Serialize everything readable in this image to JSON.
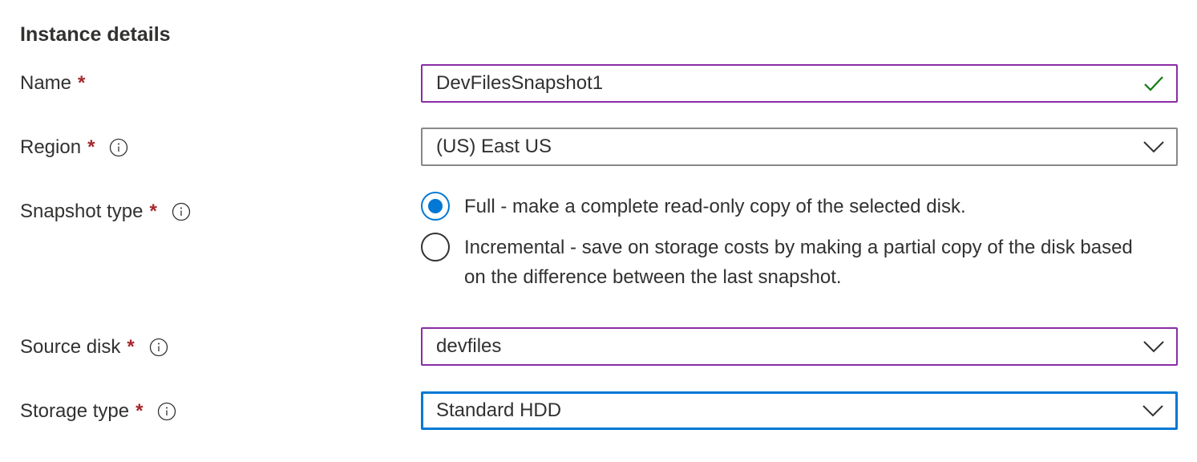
{
  "section": {
    "title": "Instance details"
  },
  "required_marker": "*",
  "fields": {
    "name": {
      "label": "Name",
      "value": "DevFilesSnapshot1",
      "valid_icon": "checkmark-icon"
    },
    "region": {
      "label": "Region",
      "value": "(US) East US",
      "icon": "chevron-down-icon"
    },
    "snapshot_type": {
      "label": "Snapshot type",
      "options": [
        {
          "label": "Full - make a complete read-only copy of the selected disk.",
          "selected": true
        },
        {
          "label": "Incremental - save on storage costs by making a partial copy of the disk based on the difference between the last snapshot.",
          "selected": false
        }
      ]
    },
    "source_disk": {
      "label": "Source disk",
      "value": "devfiles",
      "icon": "chevron-down-icon"
    },
    "storage_type": {
      "label": "Storage type",
      "value": "Standard HDD",
      "icon": "chevron-down-icon"
    }
  },
  "colors": {
    "accent": "#0078d4",
    "required": "#a4262c",
    "valid": "#107c10",
    "hover_border": "#8a2da5",
    "default_border": "#8a8886"
  }
}
